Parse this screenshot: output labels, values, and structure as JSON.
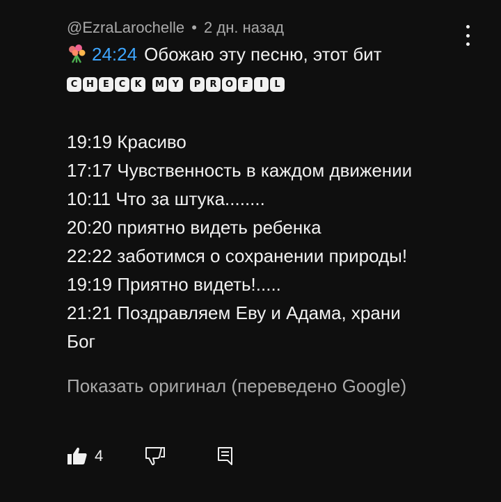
{
  "comment": {
    "author": "@EzraLarochelle",
    "separator": "•",
    "time": "2 дн. назад",
    "timestamp": "24:24",
    "first_text": "Обожаю эту песню, этот бит",
    "boxed_words": [
      "CHECK",
      "MY",
      "PROFIL"
    ],
    "lines": [
      "19:19 Красиво",
      "17:17 Чувственность в каждом движении",
      "10:11  Что за штука........",
      "20:20 приятно видеть ребенка",
      "22:22  заботимся о сохранении природы!",
      "19:19  Приятно видеть!.....",
      "21:21  Поздравляем Еву и Адама, храни",
      "Бог"
    ],
    "translate_label": "Показать оригинал (переведено Google)"
  },
  "actions": {
    "like_count": "4"
  },
  "icons": {
    "flower": "flower-bouquet-icon",
    "menu": "more-vertical-icon",
    "like": "thumbs-up-icon",
    "dislike": "thumbs-down-icon",
    "reply": "reply-icon"
  },
  "colors": {
    "background": "#0f0f0f",
    "text": "#f1f1f1",
    "secondary": "#aaaaaa",
    "link": "#3ea6ff"
  }
}
